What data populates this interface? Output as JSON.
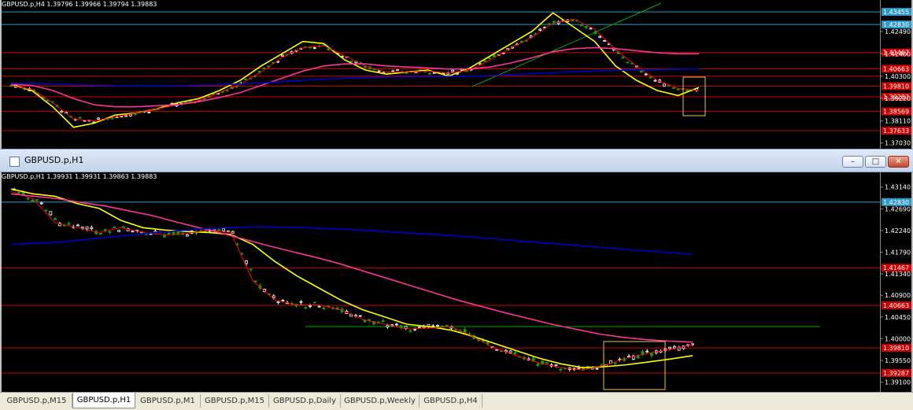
{
  "colors": {
    "ma_yellow": "#ffff00",
    "ma_red": "#ff0000",
    "ma_magenta": "#ff3399",
    "ma_blue": "#0000cc",
    "ma_green": "#00aa00",
    "level_red": "#cc0000",
    "level_cyan": "#3399cc",
    "box": "#e6c84a",
    "candle_up": "#ffffff",
    "candle_down": "#00aa00"
  },
  "charts": {
    "h4": {
      "header": "GBPUSD.p,H4  1.39796 1.39966 1.39794 1.39883",
      "price_range": [
        1.369,
        1.438
      ],
      "axis_ticks": [
        "1.42490",
        "1.41400",
        "1.40300",
        "1.39220",
        "1.38110",
        "1.37030"
      ],
      "levels": [
        {
          "price": 1.4345,
          "label": "1.43455",
          "type": "cyan"
        },
        {
          "price": 1.4283,
          "label": "1.42830",
          "type": "cyan"
        },
        {
          "price": 1.4146,
          "label": "1.41467",
          "type": "red"
        },
        {
          "price": 1.4066,
          "label": "1.40663",
          "type": "red"
        },
        {
          "price": 1.403,
          "label": "",
          "type": "red"
        },
        {
          "price": 1.3981,
          "label": "1.39810",
          "type": "red"
        },
        {
          "price": 1.3929,
          "label": "1.39287",
          "type": "red"
        },
        {
          "price": 1.3857,
          "label": "1.38569",
          "type": "red"
        },
        {
          "price": 1.3763,
          "label": "1.37633",
          "type": "red"
        }
      ]
    },
    "h1": {
      "title": "GBPUSD.p,H1",
      "header": "GBPUSD.p,H1  1.39931 1.39931 1.39863 1.39883",
      "price_range": [
        1.3898,
        1.4338
      ],
      "axis_ticks": [
        "1.43140",
        "1.42690",
        "1.42240",
        "1.41790",
        "1.41340",
        "1.40900",
        "1.40450",
        "1.40000",
        "1.39550",
        "1.39100"
      ],
      "levels": [
        {
          "price": 1.4283,
          "label": "1.42830",
          "type": "cyan"
        },
        {
          "price": 1.4147,
          "label": "1.41467",
          "type": "red"
        },
        {
          "price": 1.4069,
          "label": "1.40663",
          "type": "red"
        },
        {
          "price": 1.3981,
          "label": "1.39810",
          "type": "red"
        },
        {
          "price": 1.3929,
          "label": "1.39287",
          "type": "red"
        }
      ]
    }
  },
  "chart_data": [
    {
      "type": "line",
      "title": "GBPUSD.p,H4",
      "ohlc_header": "GBPUSD.p,H4 1.39796 1.39966 1.39794 1.39883",
      "series": [
        {
          "values": [
            1.399,
            1.396,
            1.388,
            1.378,
            1.38,
            1.384,
            1.385,
            1.387,
            1.39,
            1.392,
            1.396,
            1.401,
            1.408,
            1.414,
            1.42,
            1.419,
            1.411,
            1.406,
            1.404,
            1.405,
            1.406,
            1.403,
            1.407,
            1.413,
            1.419,
            1.425,
            1.434,
            1.427,
            1.42,
            1.408,
            1.401,
            1.396,
            1.3935,
            1.3975
          ]
        },
        {
          "values": [
            1.3985,
            1.3965,
            1.39,
            1.382,
            1.381,
            1.383,
            1.385,
            1.387,
            1.389,
            1.391,
            1.395,
            1.399,
            1.405,
            1.412,
            1.417,
            1.418,
            1.413,
            1.408,
            1.405,
            1.405,
            1.4055,
            1.4045,
            1.406,
            1.411,
            1.417,
            1.422,
            1.429,
            1.431,
            1.426,
            1.416,
            1.408,
            1.401,
            1.397,
            1.396
          ]
        },
        {
          "values": [
            1.399,
            1.3985,
            1.396,
            1.392,
            1.389,
            1.388,
            1.388,
            1.3885,
            1.389,
            1.3905,
            1.3925,
            1.395,
            1.3985,
            1.402,
            1.4055,
            1.408,
            1.409,
            1.409,
            1.408,
            1.4075,
            1.407,
            1.4065,
            1.4065,
            1.4075,
            1.4095,
            1.412,
            1.415,
            1.4165,
            1.417,
            1.4165,
            1.4155,
            1.4145,
            1.414,
            1.414
          ]
        },
        {
          "values": [
            1.3995,
            1.3995,
            1.3992,
            1.3988,
            1.3985,
            1.3983,
            1.3982,
            1.3982,
            1.3983,
            1.3985,
            1.3988,
            1.3992,
            1.3997,
            1.4003,
            1.401,
            1.4016,
            1.402,
            1.4023,
            1.4025,
            1.4026,
            1.4027,
            1.4028,
            1.403,
            1.4033,
            1.4037,
            1.4042,
            1.4047,
            1.4052,
            1.4055,
            1.4058,
            1.406,
            1.4062,
            1.4064,
            1.4066
          ]
        }
      ]
    },
    {
      "type": "line",
      "title": "GBPUSD.p,H1",
      "ohlc_header": "GBPUSD.p,H1 1.39931 1.39931 1.39863 1.39883",
      "series": [
        {
          "values": [
            1.431,
            1.43,
            1.4295,
            1.428,
            1.427,
            1.4245,
            1.423,
            1.4225,
            1.4222,
            1.422,
            1.4216,
            1.4195,
            1.416,
            1.413,
            1.4105,
            1.408,
            1.406,
            1.4045,
            1.403,
            1.4025,
            1.4018,
            1.4005,
            1.399,
            1.3975,
            1.396,
            1.3948,
            1.394,
            1.3942,
            1.3946,
            1.3952,
            1.3958,
            1.3965
          ]
        },
        {
          "values": [
            1.4305,
            1.429,
            1.424,
            1.423,
            1.422,
            1.423,
            1.422,
            1.4215,
            1.4218,
            1.4225,
            1.422,
            1.412,
            1.408,
            1.407,
            1.407,
            1.406,
            1.404,
            1.403,
            1.402,
            1.4022,
            1.4025,
            1.4005,
            1.398,
            1.3965,
            1.395,
            1.394,
            1.3935,
            1.3945,
            1.396,
            1.397,
            1.3978,
            1.3988
          ]
        },
        {
          "values": [
            1.43,
            1.4295,
            1.429,
            1.4282,
            1.4275,
            1.4265,
            1.4255,
            1.4242,
            1.423,
            1.4218,
            1.4205,
            1.4192,
            1.418,
            1.4168,
            1.4155,
            1.414,
            1.4125,
            1.411,
            1.4095,
            1.408,
            1.4067,
            1.4054,
            1.4042,
            1.403,
            1.402,
            1.401,
            1.4003,
            1.3998,
            1.3995,
            1.3993
          ]
        },
        {
          "values": [
            1.4195,
            1.42,
            1.421,
            1.422,
            1.4228,
            1.4232,
            1.423,
            1.4226,
            1.422,
            1.4214,
            1.4206,
            1.4198,
            1.419,
            1.4182,
            1.4175
          ]
        }
      ]
    }
  ],
  "window": {
    "title": "GBPUSD.p,H1",
    "min_glyph": "–",
    "max_glyph": "□",
    "close_glyph": "✕"
  },
  "tabs": [
    "GBPUSD.p,M15",
    "GBPUSD.p,H1",
    "GBPUSD.p,M1",
    "GBPUSD.p,M15",
    "GBPUSD.p,Daily",
    "GBPUSD.p,Weekly",
    "GBPUSD.p,H4"
  ],
  "active_tab": 1
}
